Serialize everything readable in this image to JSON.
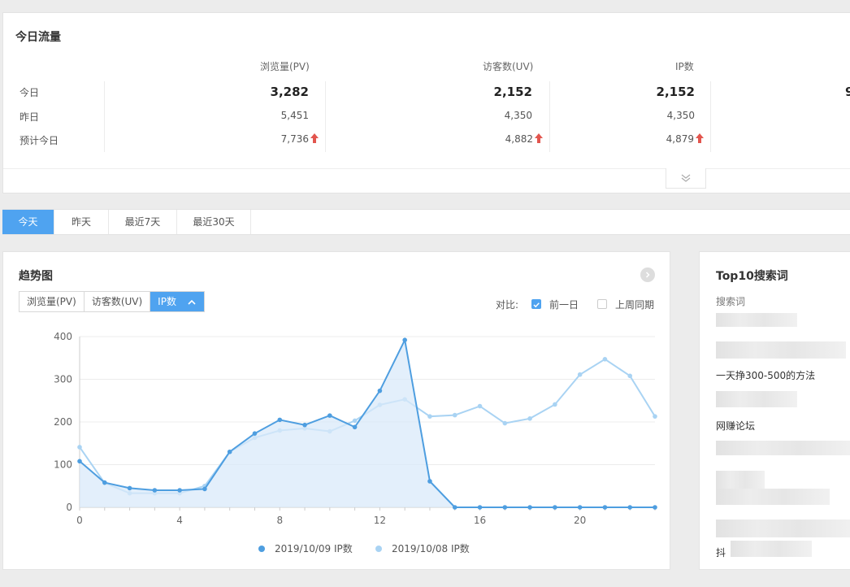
{
  "traffic": {
    "title": "今日流量",
    "columns": [
      "浏览量(PV)",
      "访客数(UV)",
      "IP数",
      "9"
    ],
    "rows": [
      {
        "label": "今日",
        "values": [
          "3,282",
          "2,152",
          "2,152"
        ]
      },
      {
        "label": "昨日",
        "values": [
          "5,451",
          "4,350",
          "4,350"
        ]
      },
      {
        "label": "预计今日",
        "values": [
          "7,736",
          "4,882",
          "4,879"
        ]
      }
    ],
    "up_color": "#e2554e"
  },
  "tabs": {
    "items": [
      "今天",
      "昨天",
      "最近7天",
      "最近30天"
    ],
    "active": 0
  },
  "trend": {
    "title": "趋势图",
    "metric_tabs": [
      "浏览量(PV)",
      "访客数(UV)",
      "IP数"
    ],
    "active_metric": 2,
    "compare_label": "对比:",
    "compare_options": [
      {
        "label": "前一日",
        "checked": true
      },
      {
        "label": "上周同期",
        "checked": false
      }
    ]
  },
  "chart_data": {
    "type": "area",
    "x": [
      0,
      1,
      2,
      3,
      4,
      5,
      6,
      7,
      8,
      9,
      10,
      11,
      12,
      13,
      14,
      15,
      16,
      17,
      18,
      19,
      20,
      21,
      22,
      23
    ],
    "x_ticks": [
      0,
      4,
      8,
      12,
      16,
      20
    ],
    "y_ticks": [
      0,
      100,
      200,
      300,
      400
    ],
    "ylim": [
      0,
      400
    ],
    "xlim": [
      0,
      23
    ],
    "grid": true,
    "legend_position": "bottom",
    "series": [
      {
        "name": "2019/10/09 IP数",
        "color": "#4e9ee0",
        "values": [
          108,
          58,
          45,
          40,
          40,
          43,
          130,
          173,
          205,
          193,
          215,
          188,
          273,
          392,
          61,
          0,
          0,
          0,
          0,
          0,
          0,
          0,
          0,
          0
        ]
      },
      {
        "name": "2019/10/08 IP数",
        "color": "#a9d3f3",
        "values": [
          141,
          57,
          33,
          33,
          33,
          50,
          130,
          163,
          180,
          185,
          178,
          203,
          240,
          253,
          213,
          216,
          237,
          197,
          208,
          241,
          311,
          347,
          308,
          213
        ]
      }
    ]
  },
  "top10": {
    "title": "Top10搜索词",
    "header": "搜索词",
    "keywords": [
      "一天挣300-500的方法",
      "网赚论坛",
      "抖"
    ]
  }
}
